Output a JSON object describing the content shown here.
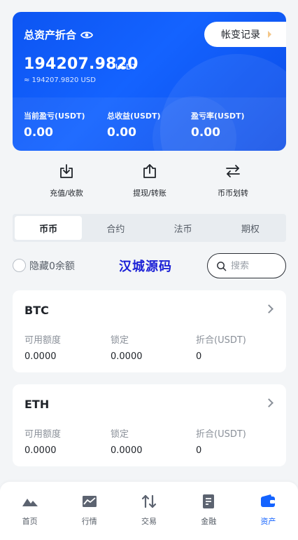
{
  "asset_card": {
    "title": "总资产折合",
    "ledger_label": "帐变记录",
    "total_amount": "194207.9820",
    "unit": "USDT",
    "approx_usd": "≈ 194207.9820 USD",
    "stats": [
      {
        "label": "当前盈亏(USDT)",
        "value": "0.00"
      },
      {
        "label": "总收益(USDT)",
        "value": "0.00"
      },
      {
        "label": "盈亏率(USDT)",
        "value": "0.00"
      }
    ]
  },
  "actions": [
    {
      "label": "充值/收款",
      "icon": "download-icon"
    },
    {
      "label": "提现/转账",
      "icon": "upload-icon"
    },
    {
      "label": "币币划转",
      "icon": "transfer-icon"
    }
  ],
  "tabs": [
    {
      "label": "币币",
      "active": true
    },
    {
      "label": "合约",
      "active": false
    },
    {
      "label": "法币",
      "active": false
    },
    {
      "label": "期权",
      "active": false
    }
  ],
  "filter": {
    "hide_zero_label": "隐藏0余额",
    "watermark": "汉城源码",
    "search_placeholder": "搜索"
  },
  "column_labels": {
    "available": "可用额度",
    "locked": "锁定",
    "converted": "折合(USDT)"
  },
  "coins": [
    {
      "name": "BTC",
      "available": "0.0000",
      "locked": "0.0000",
      "converted": "0"
    },
    {
      "name": "ETH",
      "available": "0.0000",
      "locked": "0.0000",
      "converted": "0"
    }
  ],
  "tabbar": [
    {
      "label": "首页",
      "icon": "home-mountain-icon",
      "active": false
    },
    {
      "label": "行情",
      "icon": "chart-icon",
      "active": false
    },
    {
      "label": "交易",
      "icon": "trade-arrows-icon",
      "active": false
    },
    {
      "label": "金融",
      "icon": "document-icon",
      "active": false
    },
    {
      "label": "资产",
      "icon": "wallet-icon",
      "active": true
    }
  ],
  "colors": {
    "accent": "#1463ff",
    "card_gradient_start": "#0d55f2",
    "text_primary": "#1f2329",
    "text_muted": "#8a9099",
    "background": "#f3f5f7"
  }
}
